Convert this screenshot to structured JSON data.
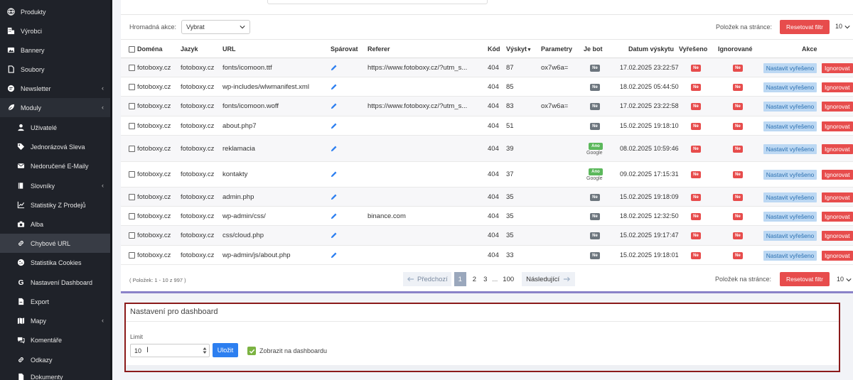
{
  "sidebar": {
    "items": [
      {
        "label": "Produkty",
        "icon": "globe-icon",
        "level": "top"
      },
      {
        "label": "Výrobci",
        "icon": "building-icon",
        "level": "top"
      },
      {
        "label": "Bannery",
        "icon": "image-icon",
        "level": "top"
      },
      {
        "label": "Soubory",
        "icon": "file-icon",
        "level": "top"
      },
      {
        "label": "Newsletter",
        "icon": "newsletter-icon",
        "level": "top",
        "chevron": "‹"
      },
      {
        "label": "Moduly",
        "icon": "leaf-icon",
        "level": "top",
        "chevron": "‹"
      },
      {
        "label": "Uživatelé",
        "icon": "user-icon",
        "level": "sub"
      },
      {
        "label": "Jednorázová Sleva",
        "icon": "tag-icon",
        "level": "sub"
      },
      {
        "label": "Nedoručené E-Maily",
        "icon": "mail-icon",
        "level": "sub"
      },
      {
        "label": "Slovníky",
        "icon": "book-icon",
        "level": "sub",
        "chevron": "‹"
      },
      {
        "label": "Statistiky Z Prodejů",
        "icon": "chart-icon",
        "level": "sub"
      },
      {
        "label": "Alba",
        "icon": "camera-icon",
        "level": "sub"
      },
      {
        "label": "Chybové URL",
        "icon": "link-icon",
        "level": "sub"
      },
      {
        "label": "Statistika Cookies",
        "icon": "cookie-icon",
        "level": "sub"
      },
      {
        "label": "Nastavení Dashboard",
        "icon": "google-icon",
        "level": "sub"
      },
      {
        "label": "Export",
        "icon": "export-icon",
        "level": "sub"
      },
      {
        "label": "Mapy",
        "icon": "map-icon",
        "level": "sub",
        "chevron": "‹"
      },
      {
        "label": "Komentáře",
        "icon": "comments-icon",
        "level": "sub"
      },
      {
        "label": "Odkazy",
        "icon": "link-icon",
        "level": "sub"
      },
      {
        "label": "Dokumenty",
        "icon": "document-icon",
        "level": "sub"
      }
    ]
  },
  "toolbar": {
    "bulk_label": "Hromadná akce:",
    "bulk_value": "Vybrat",
    "perpage_label": "Položek na stránce:",
    "reset_label": "Resetovat filtr",
    "perpage_value": "10"
  },
  "table": {
    "headers": {
      "domain": "Doména",
      "lang": "Jazyk",
      "url": "URL",
      "pair": "Spárovat",
      "referer": "Referer",
      "code": "Kód",
      "hits": "Výskyt",
      "params": "Parametry",
      "bot": "Je bot",
      "date": "Datum výskytu",
      "resolved": "Vyřešeno",
      "ignored": "Ignorované",
      "actions": "Akce"
    },
    "sort_arrow": "▼",
    "badge_no": "Ne",
    "badge_yes": "Ano",
    "resolve_label": "Nastavit vyřešeno",
    "ignore_label": "Ignorovat",
    "rows": [
      {
        "domain": "fotoboxy.cz",
        "lang": "fotoboxy.cz",
        "url": "fonts/icomoon.ttf",
        "referer": "https://www.fotoboxy.cz/?utm_s...",
        "code": "404",
        "hits": "87",
        "params": "ox7w6a=",
        "bot": "Ne",
        "bot_sub": "",
        "date": "17.02.2025 23:22:57"
      },
      {
        "domain": "fotoboxy.cz",
        "lang": "fotoboxy.cz",
        "url": "wp-includes/wlwmanifest.xml",
        "referer": "",
        "code": "404",
        "hits": "85",
        "params": "",
        "bot": "Ne",
        "bot_sub": "",
        "date": "18.02.2025 05:44:50"
      },
      {
        "domain": "fotoboxy.cz",
        "lang": "fotoboxy.cz",
        "url": "fonts/icomoon.woff",
        "referer": "https://www.fotoboxy.cz/?utm_s...",
        "code": "404",
        "hits": "83",
        "params": "ox7w6a=",
        "bot": "Ne",
        "bot_sub": "",
        "date": "17.02.2025 23:22:58"
      },
      {
        "domain": "fotoboxy.cz",
        "lang": "fotoboxy.cz",
        "url": "about.php7",
        "referer": "",
        "code": "404",
        "hits": "51",
        "params": "",
        "bot": "Ne",
        "bot_sub": "",
        "date": "15.02.2025 19:18:10"
      },
      {
        "domain": "fotoboxy.cz",
        "lang": "fotoboxy.cz",
        "url": "reklamacia",
        "referer": "",
        "code": "404",
        "hits": "39",
        "params": "",
        "bot": "Ano",
        "bot_sub": "Google",
        "date": "08.02.2025 10:59:46"
      },
      {
        "domain": "fotoboxy.cz",
        "lang": "fotoboxy.cz",
        "url": "kontakty",
        "referer": "",
        "code": "404",
        "hits": "37",
        "params": "",
        "bot": "Ano",
        "bot_sub": "Google",
        "date": "09.02.2025 17:15:31"
      },
      {
        "domain": "fotoboxy.cz",
        "lang": "fotoboxy.cz",
        "url": "admin.php",
        "referer": "",
        "code": "404",
        "hits": "35",
        "params": "",
        "bot": "Ne",
        "bot_sub": "",
        "date": "15.02.2025 19:18:09"
      },
      {
        "domain": "fotoboxy.cz",
        "lang": "fotoboxy.cz",
        "url": "wp-admin/css/",
        "referer": "binance.com",
        "code": "404",
        "hits": "35",
        "params": "",
        "bot": "Ne",
        "bot_sub": "",
        "date": "18.02.2025 12:32:50"
      },
      {
        "domain": "fotoboxy.cz",
        "lang": "fotoboxy.cz",
        "url": "css/cloud.php",
        "referer": "",
        "code": "404",
        "hits": "35",
        "params": "",
        "bot": "Ne",
        "bot_sub": "",
        "date": "15.02.2025 19:17:47"
      },
      {
        "domain": "fotoboxy.cz",
        "lang": "fotoboxy.cz",
        "url": "wp-admin/js/about.php",
        "referer": "",
        "code": "404",
        "hits": "33",
        "params": "",
        "bot": "Ne",
        "bot_sub": "",
        "date": "15.02.2025 19:18:01"
      }
    ]
  },
  "footer": {
    "info": "( Položek: 1 - 10 z 997 )",
    "prev": "Předchozí",
    "pages": [
      "1",
      "2",
      "3"
    ],
    "dots": "...",
    "last": "100",
    "next": "Následující",
    "perpage_label": "Položek na stránce:",
    "reset_label": "Resetovat filtr",
    "perpage_value": "10"
  },
  "dashboard": {
    "title": "Nastavení pro dashboard",
    "limit_label": "Limit",
    "limit_value": "10",
    "save_label": "Uložit",
    "show_label": "Zobrazit na dashboardu",
    "show_checked": true
  }
}
